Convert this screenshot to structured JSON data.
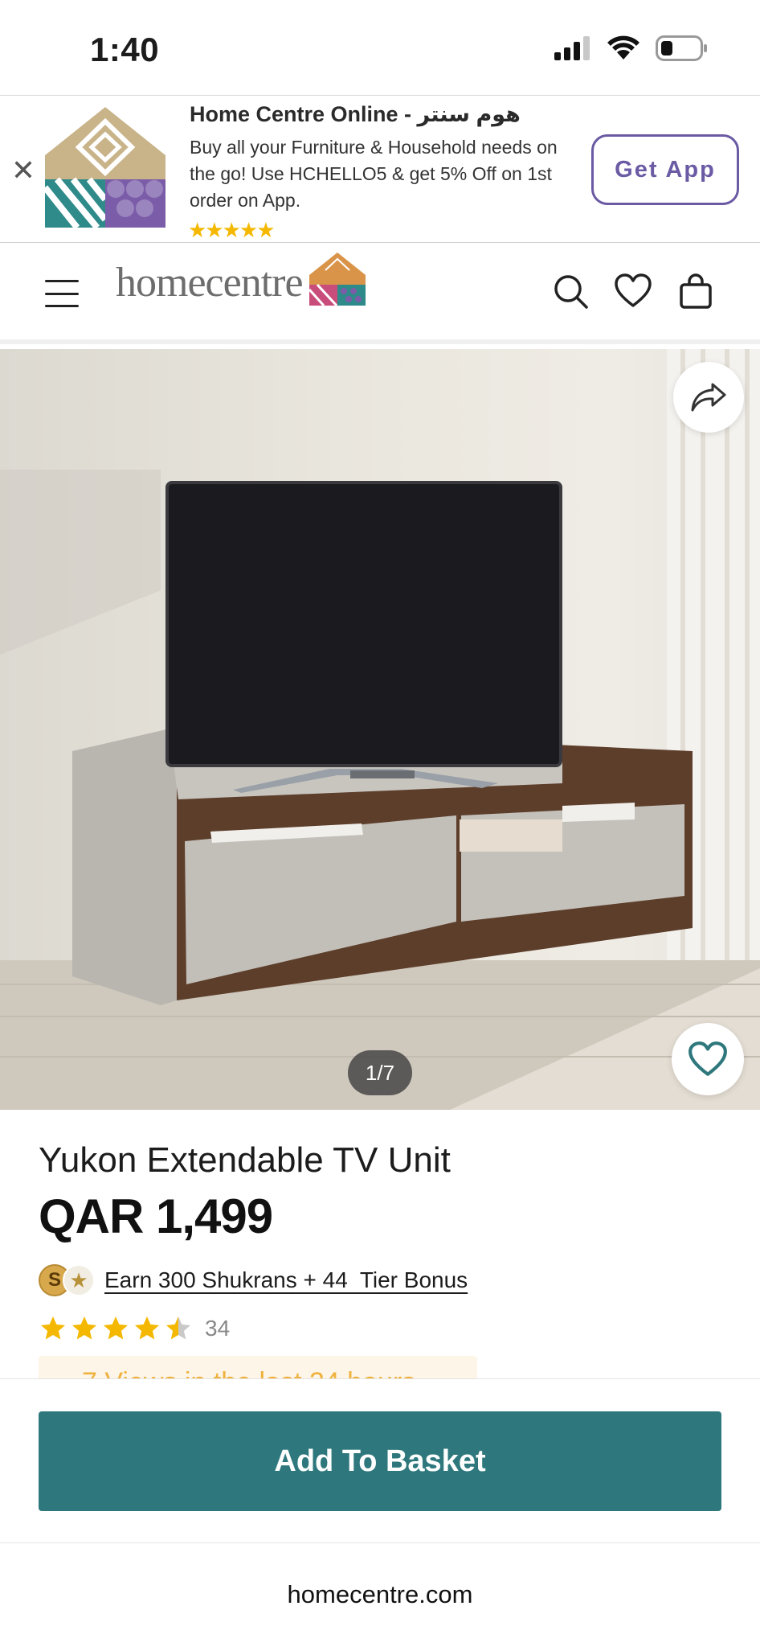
{
  "status_bar": {
    "time": "1:40",
    "icons": [
      "signal-icon",
      "wifi-icon",
      "battery-icon"
    ]
  },
  "app_banner": {
    "title": "Home Centre Online - هوم سنتر",
    "description": "Buy all your Furniture & Household needs on the go! Use HCHELLO5 & get 5% Off on 1st order on App.",
    "rating_stars": "★★★★★",
    "get_app_label": "Get App",
    "close_symbol": "✕"
  },
  "header": {
    "logo_text": "homecentre",
    "icons": [
      "menu-icon",
      "search-icon",
      "heart-icon",
      "bag-icon"
    ]
  },
  "gallery": {
    "counter": "1/7"
  },
  "product": {
    "title": "Yukon Extendable TV Unit",
    "price": "QAR 1,499",
    "shukrans_coin_letter": "S",
    "shukrans_star": "★",
    "shukrans_text": "Earn 300 Shukrans + 44  Tier Bonus",
    "rating_value": 4.5,
    "rating_count": "34",
    "views_text": "7 Views in the last 24 hours"
  },
  "basket": {
    "button_label": "Add To Basket"
  },
  "browser": {
    "url": "homecentre.com"
  },
  "colors": {
    "teal": "#2e787d",
    "purple": "#6b5aa4",
    "star_gold": "#f5b800"
  }
}
